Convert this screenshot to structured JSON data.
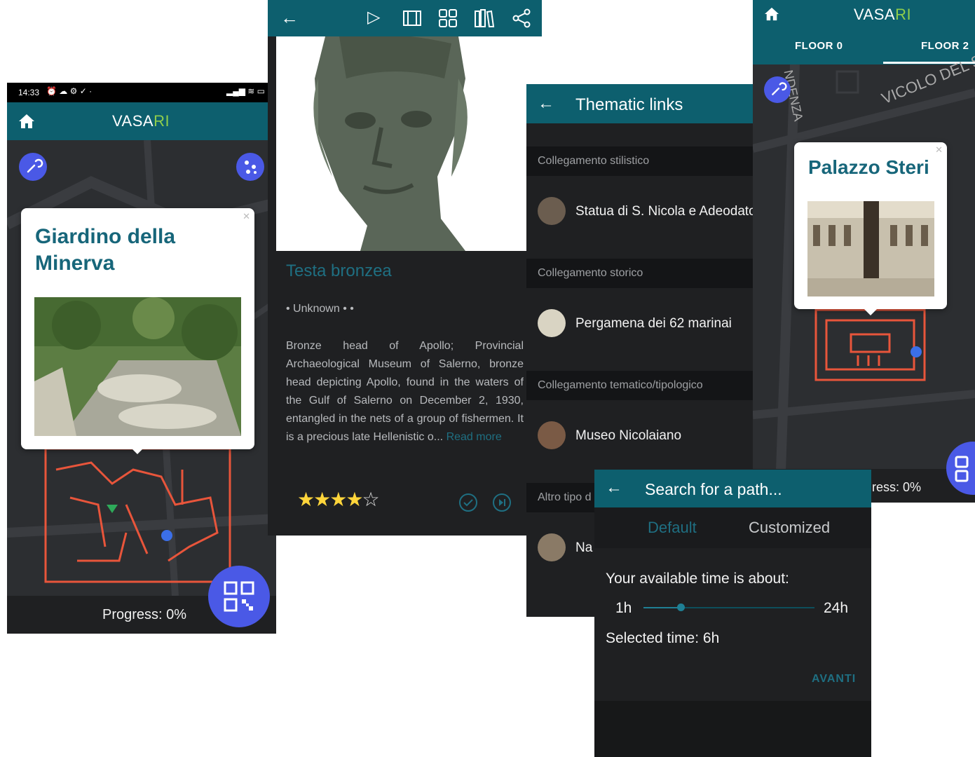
{
  "s1": {
    "status_time": "14:33",
    "app_title": "VASA",
    "app_title_accent": "RI",
    "card_title": "Giardino della Minerva",
    "progress": "Progress: 0%"
  },
  "s2": {
    "title": "Testa bronzea",
    "meta": "• Unknown • •",
    "description": "Bronze head of Apollo; Provincial Archaeological Museum of Salerno, bronze head depicting Apollo, found in the waters of the Gulf of Salerno on December 2, 1930, entangled in the nets of a group of fishermen. It is a precious late Hellenistic o...",
    "read_more": "Read more",
    "rating": 4,
    "rating_max": 5
  },
  "s3": {
    "title": "Thematic links",
    "sections": [
      {
        "header": "Collegamento stilistico",
        "item": "Statua di S. Nicola e Adeodato"
      },
      {
        "header": "Collegamento storico",
        "item": "Pergamena dei 62 marinai"
      },
      {
        "header": "Collegamento tematico/tipologico",
        "item": "Museo Nicolaiano"
      },
      {
        "header": "Altro tipo d",
        "item": "Na"
      }
    ]
  },
  "s4": {
    "app_title": "VASA",
    "app_title_accent": "RI",
    "tab_floor0": "FLOOR 0",
    "tab_floor2": "FLOOR 2",
    "street1": "VICOLO DEL S",
    "street2": "NDENZA",
    "card_title": "Palazzo Steri",
    "progress": "ress: 0%"
  },
  "s5": {
    "title": "Search for a path...",
    "tab_default": "Default",
    "tab_customized": "Customized",
    "available_time": "Your available time is about:",
    "min": "1h",
    "max": "24h",
    "selected": "Selected time: 6h",
    "slider_value": 6,
    "slider_min": 1,
    "slider_max": 24,
    "next": "AVANTI"
  },
  "colors": {
    "teal": "#0d5f6e",
    "accent_blue": "#4a59e6",
    "map_red": "#e8553b",
    "dark_bg": "#1f2022"
  }
}
